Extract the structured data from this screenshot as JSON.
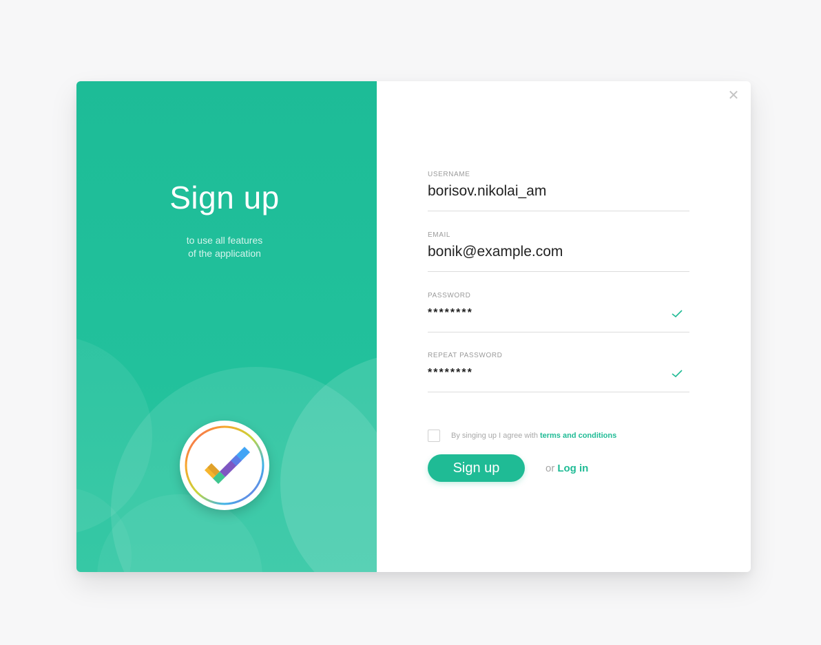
{
  "hero": {
    "title": "Sign up",
    "subtitle_line1": "to use all features",
    "subtitle_line2": "of the application"
  },
  "icons": {
    "close": "close-icon",
    "logo": "checkmark-logo-icon",
    "password_valid": "check-icon"
  },
  "form": {
    "username": {
      "label": "USERNAME",
      "value": "borisov.nikolai_am"
    },
    "email": {
      "label": "EMAIL",
      "value": "bonik@example.com"
    },
    "password": {
      "label": "PASSWORD",
      "value": "********"
    },
    "repeat_password": {
      "label": "REPEAT PASSWORD",
      "value": "********"
    },
    "terms": {
      "text": "By singing up I agree with",
      "link": "terms and conditions",
      "checked": false
    },
    "submit_label": "Sign up",
    "or_text": "or",
    "login_label": "Log in"
  },
  "colors": {
    "accent": "#1fbb95",
    "panel": "#1dbc97",
    "background": "#f7f7f8"
  }
}
